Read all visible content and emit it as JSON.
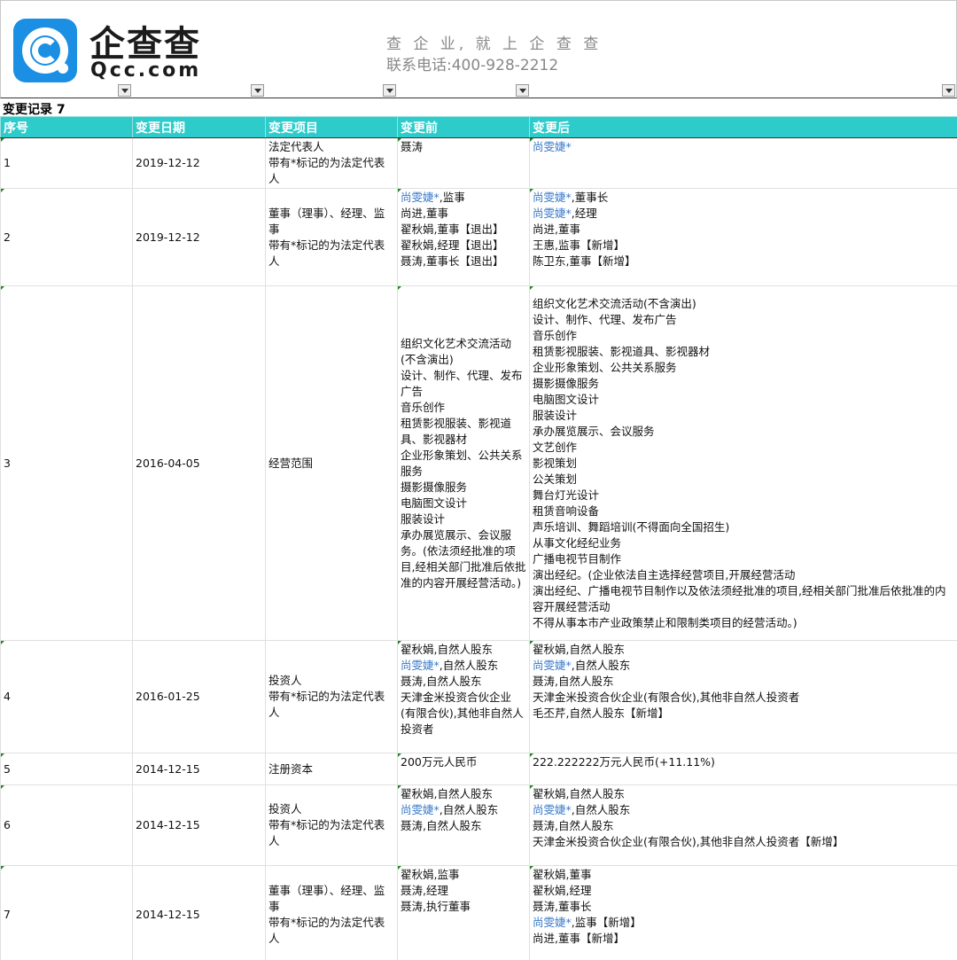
{
  "header": {
    "brand_cn": "企查查",
    "brand_en": "Qcc.com",
    "slogan": "查 企 业, 就 上 企 查 查",
    "phone": "联系电话:400-928-2212"
  },
  "section_title": "变更记录 7",
  "columns": [
    "序号",
    "变更日期",
    "变更项目",
    "变更前",
    "变更后"
  ],
  "rows": [
    {
      "no": "1",
      "date": "2019-12-12",
      "item": [
        "法定代表人",
        "带有*标记的为法定代表人"
      ],
      "before": [
        {
          "t": "聂涛"
        }
      ],
      "after": [
        {
          "t": "尚雯婕*",
          "b": true
        }
      ]
    },
    {
      "no": "2",
      "date": "2019-12-12",
      "item": [
        "董事（理事）、经理、监事",
        "带有*标记的为法定代表人"
      ],
      "before": [
        {
          "t": "尚雯婕*",
          "b": true,
          "s": ",监事"
        },
        {
          "t": "尚进,董事"
        },
        {
          "t": "翟秋娟,董事【退出】"
        },
        {
          "t": "翟秋娟,经理【退出】"
        },
        {
          "t": "聂涛,董事长【退出】"
        }
      ],
      "after": [
        {
          "t": "尚雯婕*",
          "b": true,
          "s": ",董事长"
        },
        {
          "t": "尚雯婕*",
          "b": true,
          "s": ",经理"
        },
        {
          "t": "尚进,董事"
        },
        {
          "t": "王惠,监事【新增】"
        },
        {
          "t": "陈卫东,董事【新增】"
        }
      ]
    },
    {
      "no": "3",
      "date": "2016-04-05",
      "item": [
        "经营范围"
      ],
      "before": [
        {
          "t": "组织文化艺术交流活动(不含演出)"
        },
        {
          "t": "设计、制作、代理、发布广告"
        },
        {
          "t": "音乐创作"
        },
        {
          "t": "租赁影视服装、影视道具、影视器材"
        },
        {
          "t": "企业形象策划、公共关系服务"
        },
        {
          "t": "摄影摄像服务"
        },
        {
          "t": "电脑图文设计"
        },
        {
          "t": "服装设计"
        },
        {
          "t": "承办展览展示、会议服务。(依法须经批准的项目,经相关部门批准后依批准的内容开展经营活动。)"
        }
      ],
      "after": [
        {
          "t": "组织文化艺术交流活动(不含演出)"
        },
        {
          "t": "设计、制作、代理、发布广告"
        },
        {
          "t": "音乐创作"
        },
        {
          "t": "租赁影视服装、影视道具、影视器材"
        },
        {
          "t": "企业形象策划、公共关系服务"
        },
        {
          "t": "摄影摄像服务"
        },
        {
          "t": "电脑图文设计"
        },
        {
          "t": "服装设计"
        },
        {
          "t": "承办展览展示、会议服务"
        },
        {
          "t": "文艺创作"
        },
        {
          "t": "影视策划"
        },
        {
          "t": "公关策划"
        },
        {
          "t": "舞台灯光设计"
        },
        {
          "t": "租赁音响设备"
        },
        {
          "t": "声乐培训、舞蹈培训(不得面向全国招生)"
        },
        {
          "t": "从事文化经纪业务"
        },
        {
          "t": "广播电视节目制作"
        },
        {
          "t": "演出经纪。(企业依法自主选择经营项目,开展经营活动"
        },
        {
          "t": "演出经纪、广播电视节目制作以及依法须经批准的项目,经相关部门批准后依批准的内容开展经营活动"
        },
        {
          "t": "不得从事本市产业政策禁止和限制类项目的经营活动。)"
        }
      ]
    },
    {
      "no": "4",
      "date": "2016-01-25",
      "item": [
        "投资人",
        "带有*标记的为法定代表人"
      ],
      "before": [
        {
          "t": "翟秋娟,自然人股东"
        },
        {
          "t": "尚雯婕*",
          "b": true,
          "s": ",自然人股东"
        },
        {
          "t": "聂涛,自然人股东"
        },
        {
          "t": "天津金米投资合伙企业(有限合伙),其他非自然人投资者"
        }
      ],
      "after": [
        {
          "t": "翟秋娟,自然人股东"
        },
        {
          "t": "尚雯婕*",
          "b": true,
          "s": ",自然人股东"
        },
        {
          "t": "聂涛,自然人股东"
        },
        {
          "t": "天津金米投资合伙企业(有限合伙),其他非自然人投资者"
        },
        {
          "t": "毛丕芹,自然人股东【新增】"
        }
      ]
    },
    {
      "no": "5",
      "date": "2014-12-15",
      "item": [
        "注册资本"
      ],
      "before": [
        {
          "t": "200万元人民币"
        }
      ],
      "after": [
        {
          "t": "222.222222万元人民币(+11.11%)"
        }
      ]
    },
    {
      "no": "6",
      "date": "2014-12-15",
      "item": [
        "投资人",
        "带有*标记的为法定代表人"
      ],
      "before": [
        {
          "t": "翟秋娟,自然人股东"
        },
        {
          "t": "尚雯婕*",
          "b": true,
          "s": ",自然人股东"
        },
        {
          "t": "聂涛,自然人股东"
        }
      ],
      "after": [
        {
          "t": "翟秋娟,自然人股东"
        },
        {
          "t": "尚雯婕*",
          "b": true,
          "s": ",自然人股东"
        },
        {
          "t": "聂涛,自然人股东"
        },
        {
          "t": "天津金米投资合伙企业(有限合伙),其他非自然人投资者【新增】"
        }
      ]
    },
    {
      "no": "7",
      "date": "2014-12-15",
      "item": [
        "董事（理事）、经理、监事",
        "带有*标记的为法定代表人"
      ],
      "before": [
        {
          "t": "翟秋娟,监事"
        },
        {
          "t": "聂涛,经理"
        },
        {
          "t": "聂涛,执行董事"
        }
      ],
      "after": [
        {
          "t": "翟秋娟,董事"
        },
        {
          "t": "翟秋娟,经理"
        },
        {
          "t": "聂涛,董事长"
        },
        {
          "t": "尚雯婕*",
          "b": true,
          "s": ",监事【新增】"
        },
        {
          "t": "尚进,董事【新增】"
        }
      ]
    }
  ],
  "colors": {
    "header_bg": "#2ecbcb",
    "link_blue": "#3a7ac8",
    "logo_blue": "#1a8fe3"
  }
}
